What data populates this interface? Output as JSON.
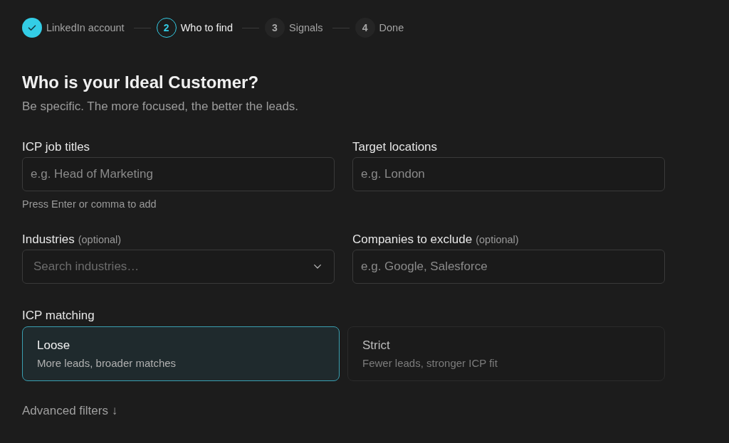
{
  "stepper": [
    {
      "label": "LinkedIn account",
      "completed": true,
      "current": false
    },
    {
      "number": "2",
      "label": "Who to find",
      "completed": false,
      "current": true
    },
    {
      "number": "3",
      "label": "Signals",
      "completed": false,
      "current": false
    },
    {
      "number": "4",
      "label": "Done",
      "completed": false,
      "current": false
    }
  ],
  "heading": {
    "title": "Who is your Ideal Customer?",
    "subtitle": "Be specific. The more focused, the better the leads."
  },
  "fields": [
    {
      "kind": "text",
      "label": "ICP job titles",
      "placeholder": "e.g. Head of Marketing",
      "hint": "Press Enter or comma to add"
    },
    {
      "kind": "text",
      "label": "Target locations",
      "placeholder": "e.g. London"
    },
    {
      "kind": "dropdown",
      "label": "Industries",
      "optional": "(optional)",
      "placeholder": "Search industries…"
    },
    {
      "kind": "text",
      "label": "Companies to exclude",
      "optional": "(optional)",
      "placeholder": "e.g. Google, Salesforce"
    }
  ],
  "icp_matching": {
    "label": "ICP matching",
    "options": [
      {
        "title": "Loose",
        "description": "More leads, broader matches",
        "selected": true
      },
      {
        "title": "Strict",
        "description": "Fewer leads, stronger ICP fit",
        "selected": false
      }
    ]
  },
  "advanced_filters": "Advanced filters ↓"
}
